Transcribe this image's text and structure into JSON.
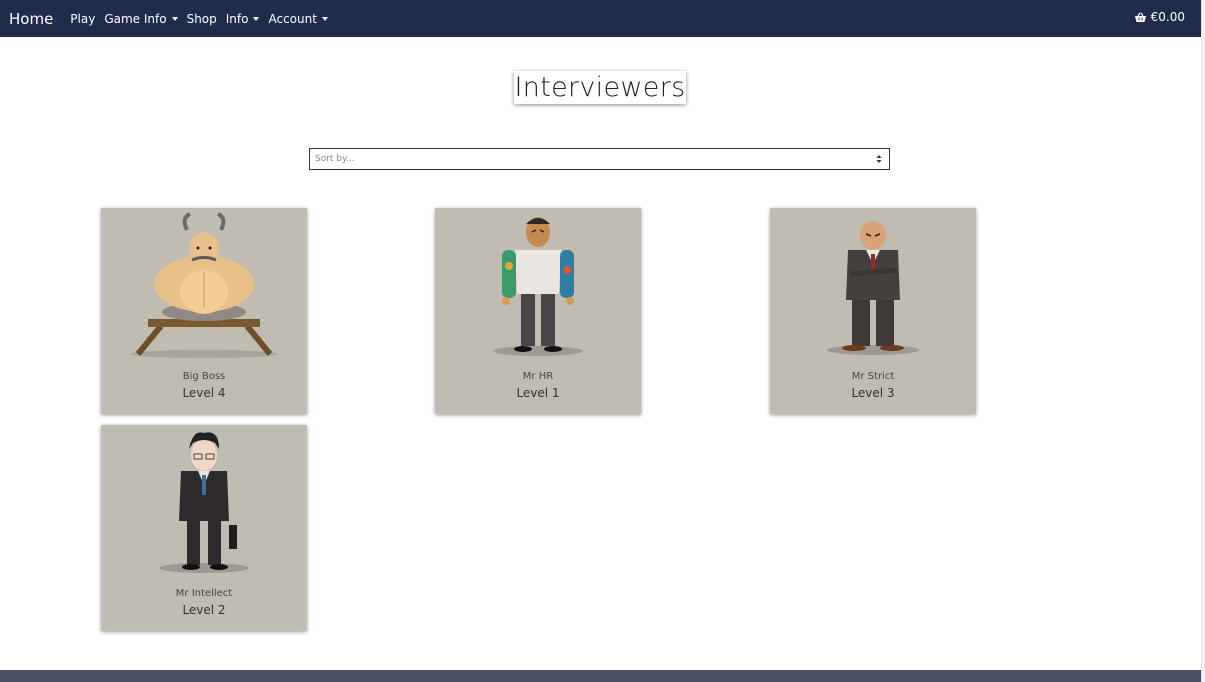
{
  "navbar": {
    "brand": "Home",
    "items": [
      {
        "label": "Play",
        "dropdown": false
      },
      {
        "label": "Game Info",
        "dropdown": true
      },
      {
        "label": "Shop",
        "dropdown": false
      },
      {
        "label": "Info",
        "dropdown": true
      },
      {
        "label": "Account",
        "dropdown": true
      }
    ],
    "cart_icon": "basket-icon",
    "cart_total": "€0.00"
  },
  "page": {
    "title": "Interviewers"
  },
  "sort": {
    "placeholder": "Sort by..."
  },
  "interviewers": [
    {
      "name": "Big Boss",
      "level": "Level 4"
    },
    {
      "name": "Mr HR",
      "level": "Level 1"
    },
    {
      "name": "Mr Strict",
      "level": "Level 3"
    },
    {
      "name": "Mr Intellect",
      "level": "Level 2"
    }
  ],
  "colors": {
    "navbar": "#212c4d",
    "card_bg": "#c1bcb2",
    "footer": "#4a5064"
  }
}
